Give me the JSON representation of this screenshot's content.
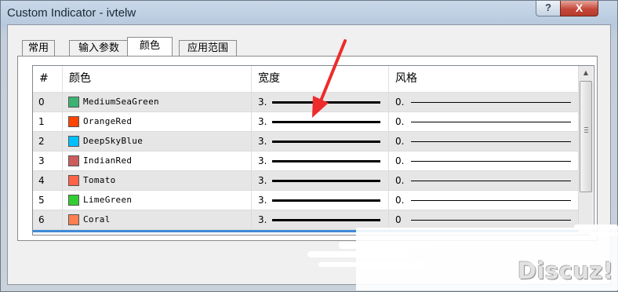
{
  "window": {
    "title": "Custom Indicator - ivtelw",
    "help_label": "?",
    "close_label": "X"
  },
  "tabs": [
    {
      "label": "常用",
      "active": false
    },
    {
      "label": "输入参数",
      "active": false
    },
    {
      "label": "颜色",
      "active": true
    },
    {
      "label": "应用范围",
      "active": false
    }
  ],
  "table": {
    "headers": [
      "#",
      "颜色",
      "宽度",
      "风格"
    ],
    "rows": [
      {
        "index": "0",
        "color_name": "MediumSeaGreen",
        "swatch": "#3cb371",
        "width": "3.",
        "style": "0."
      },
      {
        "index": "1",
        "color_name": "OrangeRed",
        "swatch": "#ff4500",
        "width": "3.",
        "style": "0."
      },
      {
        "index": "2",
        "color_name": "DeepSkyBlue",
        "swatch": "#00bfff",
        "width": "3.",
        "style": "0."
      },
      {
        "index": "3",
        "color_name": "IndianRed",
        "swatch": "#cd5c5c",
        "width": "3.",
        "style": "0."
      },
      {
        "index": "4",
        "color_name": "Tomato",
        "swatch": "#ff6347",
        "width": "3.",
        "style": "0."
      },
      {
        "index": "5",
        "color_name": "LimeGreen",
        "swatch": "#32cd32",
        "width": "3.",
        "style": "0."
      },
      {
        "index": "6",
        "color_name": "Coral",
        "swatch": "#ff7f50",
        "width": "3.",
        "style": "0"
      }
    ]
  },
  "annotation": {
    "arrow_color": "#ee2b2b"
  },
  "watermark": {
    "text": "Discuz!"
  },
  "icons": {
    "scroll_up": "up-arrow-icon",
    "thumb_grip": "grip-icon"
  }
}
